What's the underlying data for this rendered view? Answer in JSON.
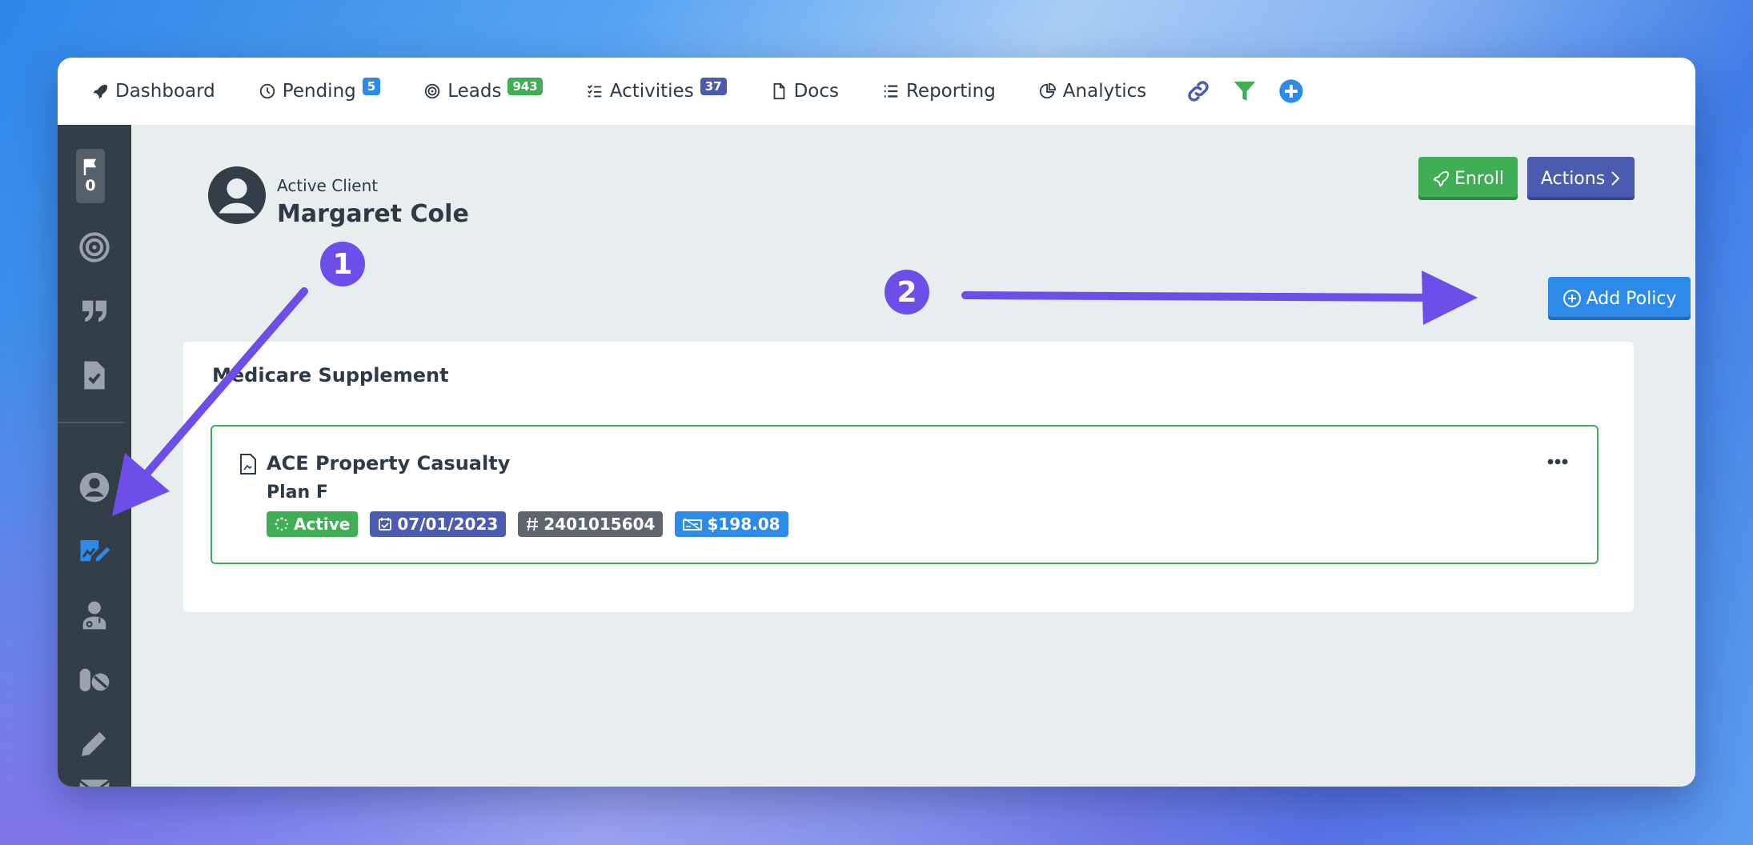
{
  "nav": {
    "items": [
      {
        "label": "Dashboard",
        "icon": "rocket-icon"
      },
      {
        "label": "Pending",
        "icon": "clock-icon",
        "badge": "5",
        "badge_color": "#2d8ae8"
      },
      {
        "label": "Leads",
        "icon": "target-icon",
        "badge": "943",
        "badge_color": "#3fae54"
      },
      {
        "label": "Activities",
        "icon": "checklist-icon",
        "badge": "37",
        "badge_color": "#4a5bb0"
      },
      {
        "label": "Docs",
        "icon": "document-icon"
      },
      {
        "label": "Reporting",
        "icon": "list-icon"
      },
      {
        "label": "Analytics",
        "icon": "pie-chart-icon"
      }
    ],
    "actions": [
      "link-icon",
      "filter-icon",
      "plus-circle-icon"
    ]
  },
  "sidebar": {
    "flag_count": "0",
    "items": [
      "flag-icon",
      "target-icon",
      "quote-icon",
      "file-check-icon",
      "user-circle-icon",
      "signature-icon",
      "doctor-icon",
      "pills-icon",
      "pencil-icon",
      "envelope-icon"
    ],
    "active": "signature-icon"
  },
  "client": {
    "status_label": "Active Client",
    "name": "Margaret Cole"
  },
  "buttons": {
    "enroll": "Enroll",
    "actions": "Actions",
    "add_policy": "Add Policy"
  },
  "section": {
    "title": "Medicare Supplement"
  },
  "policy": {
    "carrier": "ACE Property Casualty",
    "plan": "Plan F",
    "status": "Active",
    "date": "07/01/2023",
    "number": "2401015604",
    "premium": "$198.08"
  },
  "annotations": {
    "step1": "1",
    "step2": "2"
  },
  "colors": {
    "success": "#3fae54",
    "primary": "#2d8ae8",
    "indigo": "#4a5bb0",
    "secondary": "#5f666e",
    "sidebar": "#343e48",
    "annotation": "#6d4ee8"
  }
}
